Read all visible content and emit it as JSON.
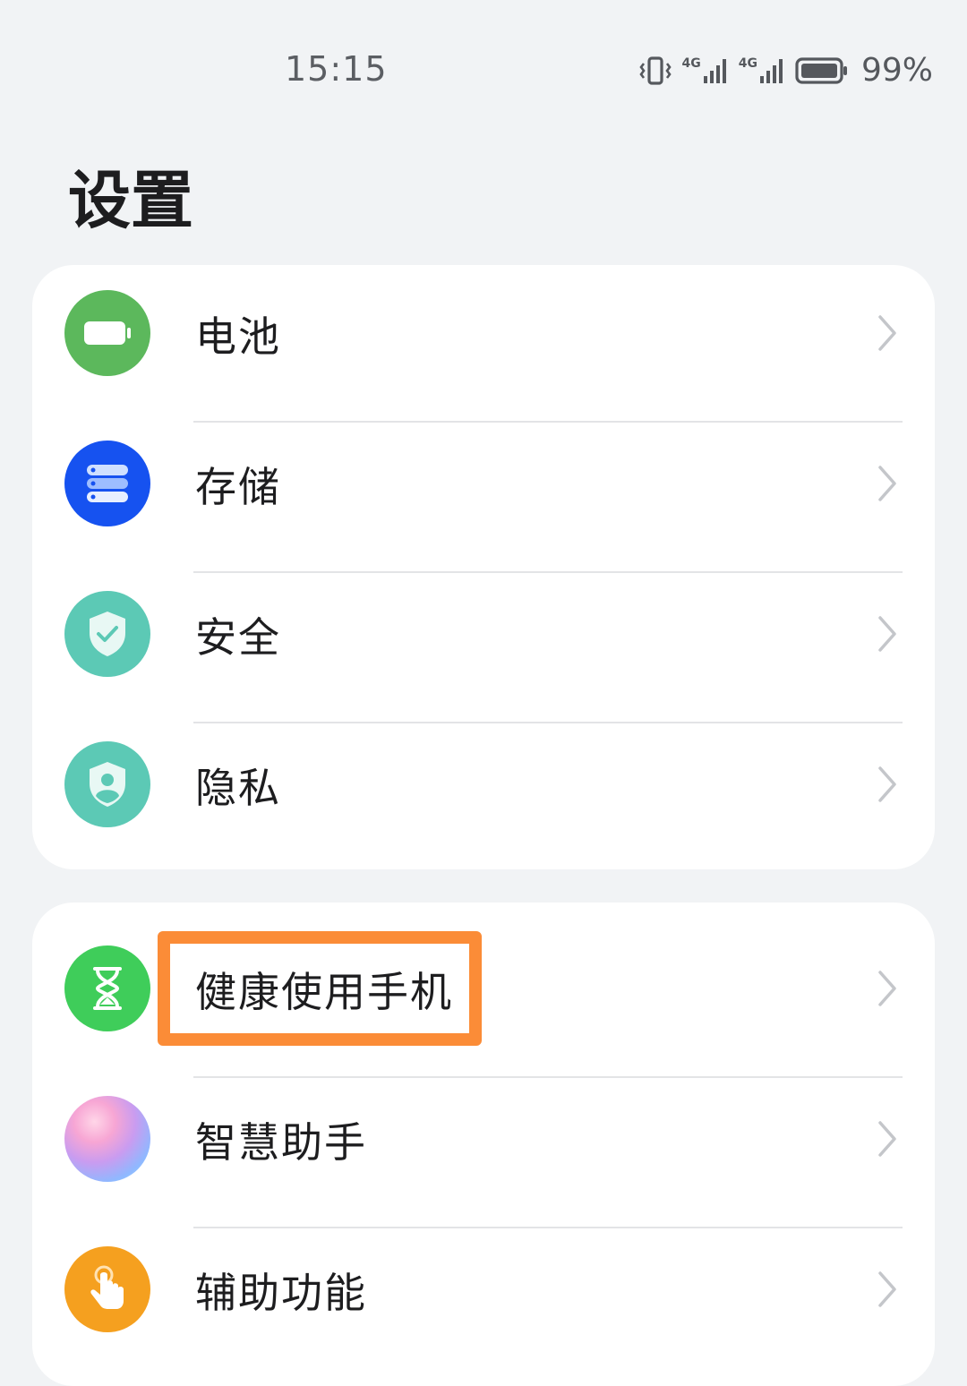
{
  "status_bar": {
    "time": "15:15",
    "network_1": "4G",
    "network_2": "4G",
    "battery_percent": "99%",
    "icons": [
      "vibrate-icon",
      "signal-4g-icon",
      "signal-4g-icon",
      "battery-icon"
    ]
  },
  "page": {
    "title": "设置"
  },
  "groups": [
    {
      "items": [
        {
          "label": "电池",
          "icon": "battery-icon",
          "color": "#5cb85c"
        },
        {
          "label": "存储",
          "icon": "storage-icon",
          "color": "#1652f0"
        },
        {
          "label": "安全",
          "icon": "shield-check-icon",
          "color": "#5cc9b5"
        },
        {
          "label": "隐私",
          "icon": "privacy-shield-icon",
          "color": "#5cc9b5"
        }
      ]
    },
    {
      "items": [
        {
          "label": "健康使用手机",
          "icon": "hourglass-icon",
          "color": "#3fcd5a"
        },
        {
          "label": "智慧助手",
          "icon": "assistant-orb-icon",
          "color": "#c99cf0"
        },
        {
          "label": "辅助功能",
          "icon": "hand-pointer-icon",
          "color": "#f5a01f"
        }
      ]
    }
  ],
  "highlight": {
    "target": "健康使用手机",
    "color": "#fb8c37"
  }
}
